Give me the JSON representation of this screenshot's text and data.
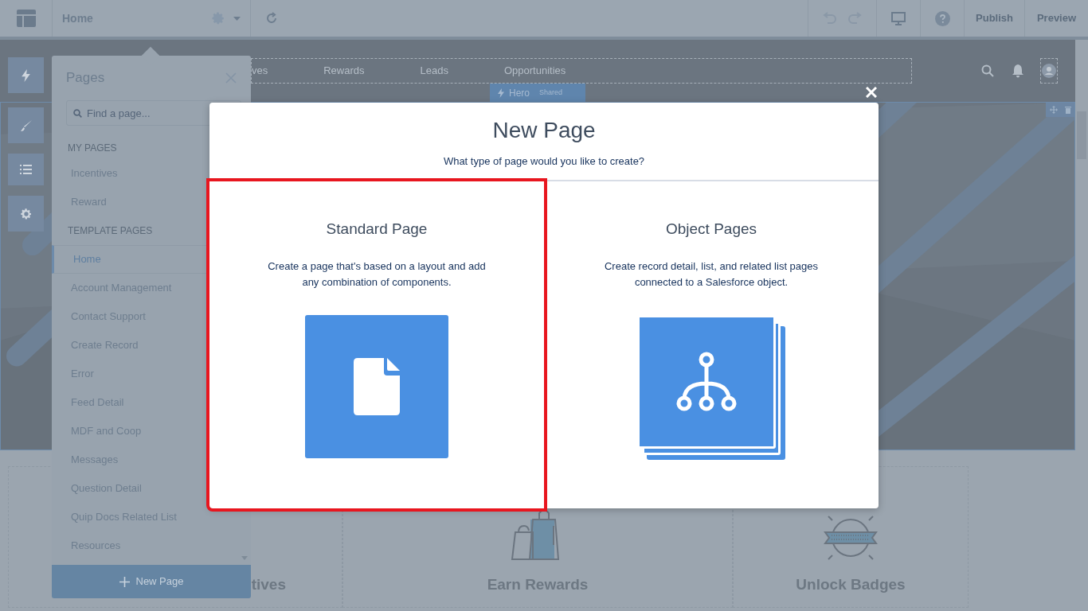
{
  "top_bar": {
    "page_name": "Home",
    "actions": [
      "Publish",
      "Preview"
    ]
  },
  "pages_panel": {
    "title": "Pages",
    "search": {
      "placeholder": "Find a page..."
    },
    "sections": [
      {
        "heading": "MY PAGES",
        "items": [
          {
            "label": "Incentives",
            "selected": false
          },
          {
            "label": "Reward",
            "selected": false
          }
        ]
      },
      {
        "heading": "TEMPLATE PAGES",
        "items": [
          {
            "label": "Home",
            "selected": true
          },
          {
            "label": "Account Management",
            "selected": false
          },
          {
            "label": "Contact Support",
            "selected": false
          },
          {
            "label": "Create Record",
            "selected": false
          },
          {
            "label": "Error",
            "selected": false
          },
          {
            "label": "Feed Detail",
            "selected": false
          },
          {
            "label": "MDF and Coop",
            "selected": false
          },
          {
            "label": "Messages",
            "selected": false
          },
          {
            "label": "Question Detail",
            "selected": false
          },
          {
            "label": "Quip Docs Related List",
            "selected": false
          },
          {
            "label": "Resources",
            "selected": false
          }
        ]
      }
    ],
    "new_button": "New Page"
  },
  "site_nav": {
    "items": [
      "ves",
      "Rewards",
      "Leads",
      "Opportunities"
    ]
  },
  "hero_tag": {
    "name": "Hero",
    "badge": "Shared"
  },
  "features": [
    {
      "title": "tives",
      "kind": "none"
    },
    {
      "title": "Earn Rewards",
      "kind": "bags"
    },
    {
      "title": "Unlock Badges",
      "kind": "badge"
    }
  ],
  "modal": {
    "title": "New Page",
    "subtitle": "What type of page would you like to create?",
    "options": [
      {
        "title": "Standard Page",
        "description": "Create a page that's based on a layout and add any combination of components.",
        "kind": "document",
        "selected": true
      },
      {
        "title": "Object Pages",
        "description": "Create record detail, list, and related list pages connected to a Salesforce object.",
        "kind": "object",
        "selected": false
      }
    ]
  }
}
